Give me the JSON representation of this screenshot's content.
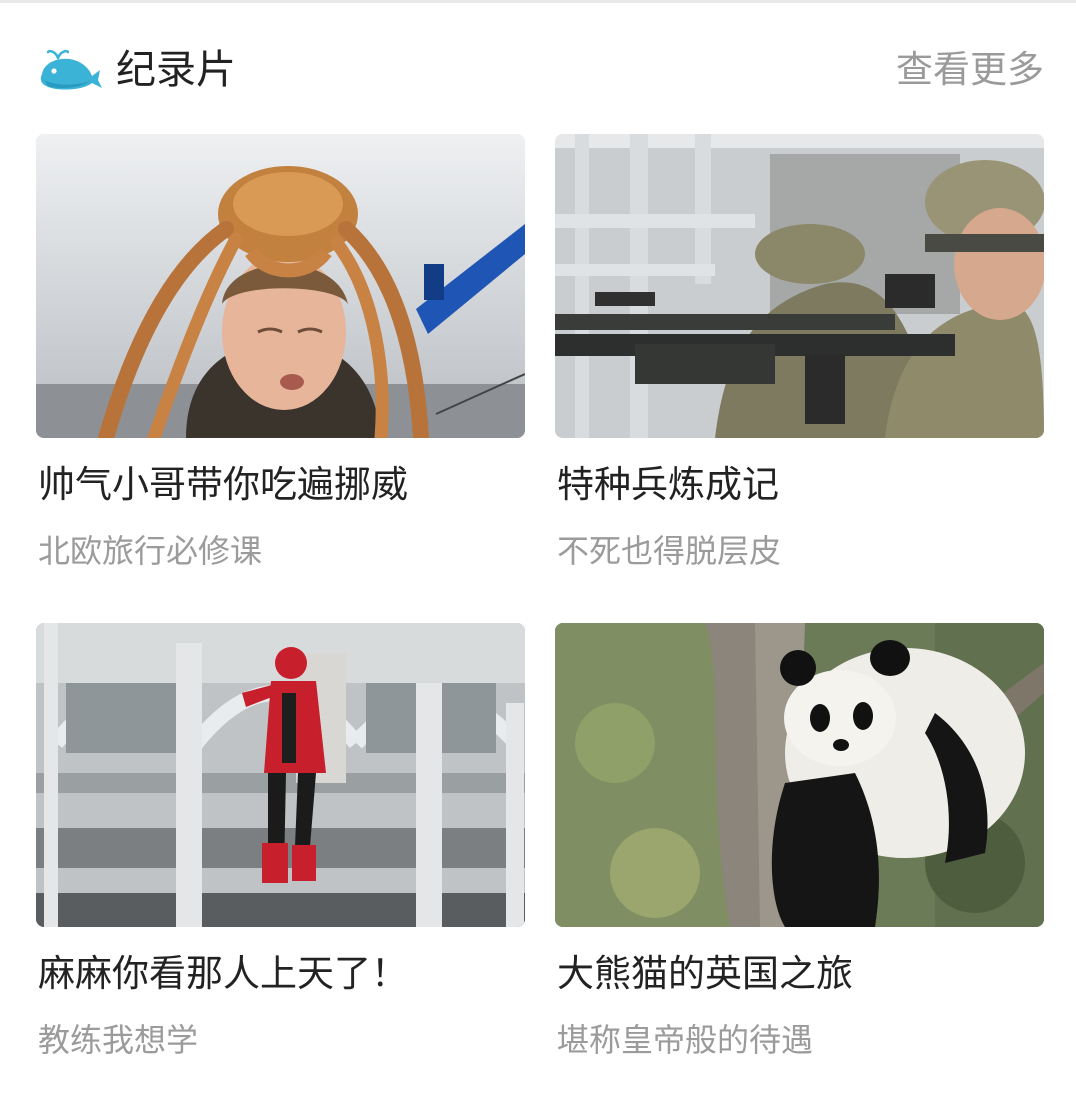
{
  "section": {
    "title": "纪录片",
    "more_label": "查看更多",
    "icon": "whale-icon"
  },
  "cards": [
    {
      "title": "帅气小哥带你吃遍挪威",
      "subtitle": "北欧旅行必修课",
      "image": "king-crab-on-head-photo"
    },
    {
      "title": "特种兵炼成记",
      "subtitle": "不死也得脱层皮",
      "image": "soldiers-aiming-rifles-photo"
    },
    {
      "title": "麻麻你看那人上天了！",
      "subtitle": "教练我想学",
      "image": "jetpack-flyer-photo"
    },
    {
      "title": "大熊猫的英国之旅",
      "subtitle": "堪称皇帝般的待遇",
      "image": "panda-in-tree-photo"
    }
  ],
  "colors": {
    "title_text": "#222222",
    "subtitle_text": "#9b9b9b",
    "more_text": "#9a9a9a",
    "whale": "#3bb3d6"
  }
}
